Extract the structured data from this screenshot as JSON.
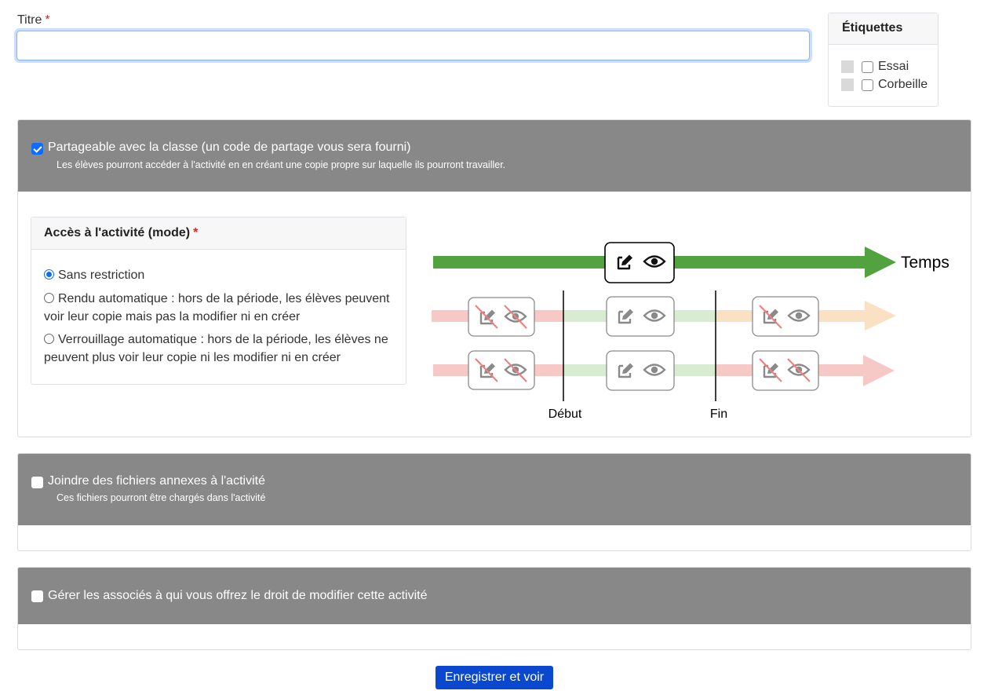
{
  "title_field": {
    "label": "Titre",
    "required_mark": "*",
    "value": ""
  },
  "tags": {
    "heading": "Étiquettes",
    "items": [
      {
        "label": "Essai",
        "checked": false
      },
      {
        "label": "Corbeille",
        "checked": false
      }
    ]
  },
  "sharing": {
    "checked": true,
    "label": "Partageable avec la classe (un code de partage vous sera fourni)",
    "description": "Les élèves pourront accéder à l'activité en en créant une copie propre sur laquelle ils pourront travailler."
  },
  "access_mode": {
    "heading": "Accès à l'activité (mode)",
    "required_mark": "*",
    "options": [
      {
        "label": "Sans restriction",
        "selected": true
      },
      {
        "label": "Rendu automatique : hors de la période, les élèves peuvent voir leur copie mais pas la modifier ni en créer",
        "selected": false
      },
      {
        "label": "Verrouillage automatique : hors de la période, les élèves ne peuvent plus voir leur copie ni les modifier ni en créer",
        "selected": false
      }
    ]
  },
  "timeline": {
    "axis_label": "Temps",
    "start_label": "Début",
    "end_label": "Fin",
    "colors": {
      "green": "#52a33f",
      "pink": "#f6c9c7",
      "light_green": "#d7ecd1",
      "peach": "#fbe1c4"
    }
  },
  "attachments": {
    "checked": false,
    "label": "Joindre des fichiers annexes à l'activité",
    "description": "Ces fichiers pourront être chargés dans l'activité"
  },
  "associates": {
    "checked": false,
    "label": "Gérer les associés à qui vous offrez le droit de modifier cette activité"
  },
  "save_button": {
    "label": "Enregistrer et voir",
    "color": "#0a48cf"
  }
}
